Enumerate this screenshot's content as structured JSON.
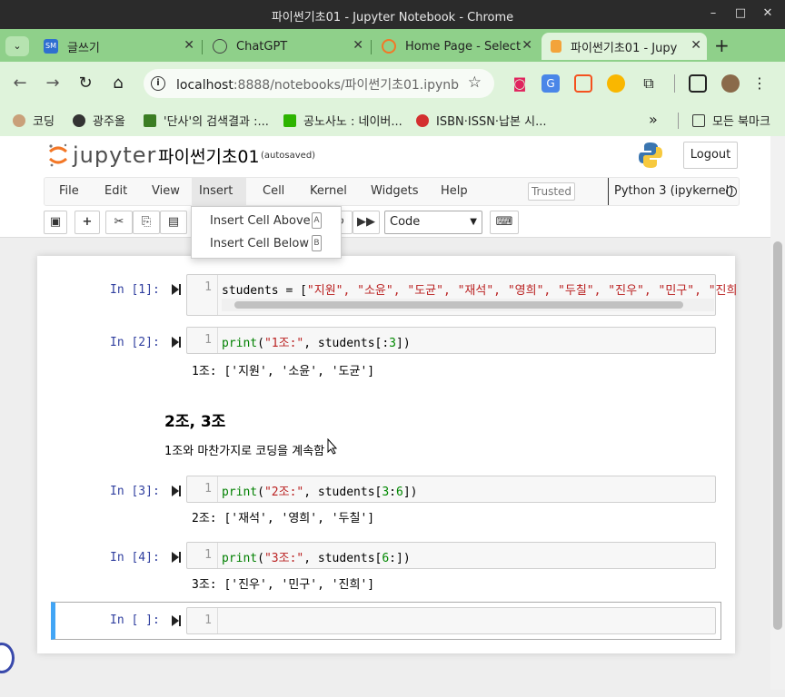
{
  "window": {
    "title": "파이썬기초01 - Jupyter Notebook - Chrome"
  },
  "tabs": [
    {
      "label": "글쓰기",
      "icon": "sm-icon"
    },
    {
      "label": "ChatGPT",
      "icon": "chatgpt-icon"
    },
    {
      "label": "Home Page - Select",
      "icon": "jupyter-icon"
    },
    {
      "label": "파이썬기초01 - Jupy",
      "icon": "notebook-icon"
    }
  ],
  "address": {
    "host": "localhost",
    "rest": ":8888/notebooks/파이썬기초01.ipynb"
  },
  "bookmarks": [
    {
      "label": "코딩"
    },
    {
      "label": "광주올"
    },
    {
      "label": "'단사'의 검색결과 :..."
    },
    {
      "label": "공노사노 : 네이버..."
    },
    {
      "label": "ISBN·ISSN·납본 시..."
    }
  ],
  "bookmarks_more": "모든 북마크",
  "jupyter": {
    "logo_text": "jupyter",
    "notebook_name": "파이썬기초01",
    "autosaved": "(autosaved)",
    "logout": "Logout",
    "menu": [
      "File",
      "Edit",
      "View",
      "Insert",
      "Cell",
      "Kernel",
      "Widgets",
      "Help"
    ],
    "trusted": "Trusted",
    "kernel": "Python 3 (ipykernel)",
    "cell_type": "Code",
    "insert_menu": [
      {
        "label": "Insert Cell Above",
        "key": "A"
      },
      {
        "label": "Insert Cell Below",
        "key": "B"
      }
    ]
  },
  "cells": [
    {
      "prompt": "In [1]:",
      "line": "1",
      "code_a": "students = [",
      "code_b": "\"지원\", \"소윤\", \"도균\", \"재석\", \"영희\", \"두칠\", \"진우\", \"민구\", \"진희"
    },
    {
      "prompt": "In [2]:",
      "line": "1",
      "code_a": "print",
      "code_b": "(",
      "code_c": "\"1조:\"",
      "code_d": ", students[:",
      "code_e": "3",
      "code_f": "])",
      "output": "1조: ['지원', '소윤', '도균']"
    },
    {
      "md_heading": "2조, 3조",
      "md_text": "1조와 마찬가지로 코딩을 계속함"
    },
    {
      "prompt": "In [3]:",
      "line": "1",
      "code_a": "print",
      "code_b": "(",
      "code_c": "\"2조:\"",
      "code_d": ", students[",
      "code_e": "3",
      "code_f": ":",
      "code_g": "6",
      "code_h": "])",
      "output": "2조: ['재석', '영희', '두칠']"
    },
    {
      "prompt": "In [4]:",
      "line": "1",
      "code_a": "print",
      "code_b": "(",
      "code_c": "\"3조:\"",
      "code_d": ", students[",
      "code_e": "6",
      "code_f": ":])",
      "output": "3조: ['진우', '민구', '진희']"
    },
    {
      "prompt": "In [ ]:",
      "line": "1"
    }
  ]
}
